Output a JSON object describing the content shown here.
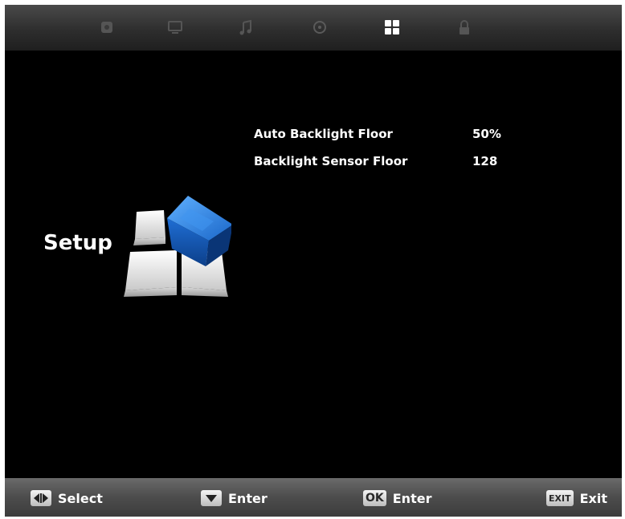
{
  "top_tabs": [
    {
      "icon": "picture-icon",
      "active": false
    },
    {
      "icon": "monitor-icon",
      "active": false
    },
    {
      "icon": "music-note-icon",
      "active": false
    },
    {
      "icon": "clock-icon",
      "active": false
    },
    {
      "icon": "setup-grid-icon",
      "active": true
    },
    {
      "icon": "lock-icon",
      "active": false
    }
  ],
  "menu": {
    "title": "Setup",
    "icon": "setup-cube-icon",
    "items": [
      {
        "label": "Auto Backlight Floor",
        "value": "50%"
      },
      {
        "label": "Backlight Sensor Floor",
        "value": "128"
      }
    ]
  },
  "footer": {
    "select": {
      "key_icon": "left-right-arrows-icon",
      "label": "Select"
    },
    "enter_down": {
      "key_icon": "down-arrow-icon",
      "label": "Enter"
    },
    "enter_ok": {
      "key": "OK",
      "label": "Enter"
    },
    "exit": {
      "key": "EXIT",
      "label": "Exit"
    }
  },
  "colors": {
    "background": "#000000",
    "text": "#ffffff",
    "cube_blue": "#1e6fd0",
    "bar_gray": "#4c4c4c"
  }
}
